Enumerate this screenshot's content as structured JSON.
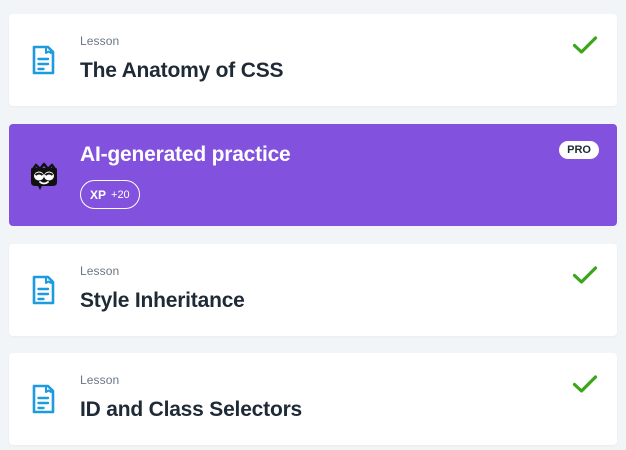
{
  "colors": {
    "page_bg": "#f2f5f7",
    "card_bg": "#ffffff",
    "pro_accent": "#8251de",
    "doc_icon": "#1e9bdf",
    "check": "#3aa61a",
    "title_text": "#1f2a37",
    "kicker_text": "#6b7785"
  },
  "items": [
    {
      "kicker": "Lesson",
      "title": "The Anatomy of CSS",
      "icon": "document-icon",
      "status": "completed"
    },
    {
      "kind": "pro",
      "title": "AI-generated practice",
      "icon": "mascot-icon",
      "xp_label": "XP",
      "xp_value": "+20",
      "badge": "PRO"
    },
    {
      "kicker": "Lesson",
      "title": "Style Inheritance",
      "icon": "document-icon",
      "status": "completed"
    },
    {
      "kicker": "Lesson",
      "title": "ID and Class Selectors",
      "icon": "document-icon",
      "status": "completed"
    }
  ]
}
